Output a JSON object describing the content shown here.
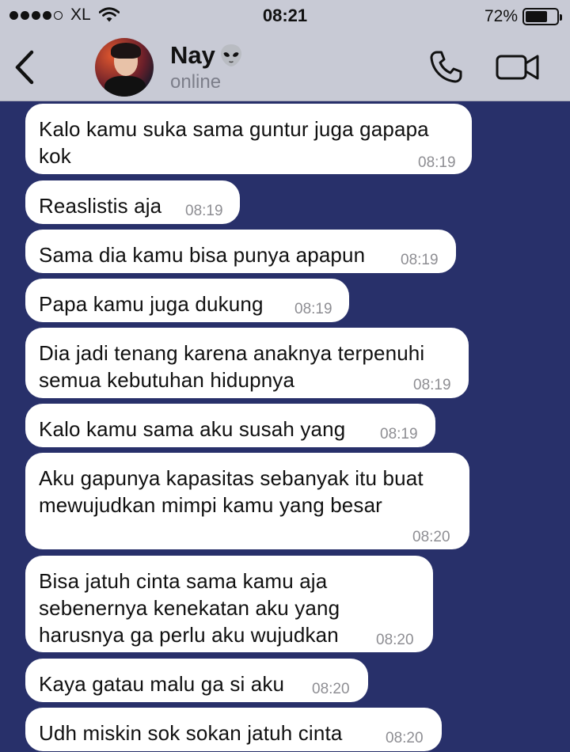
{
  "status_bar": {
    "carrier": "XL",
    "time": "08:21",
    "battery_percent": "72%",
    "battery_level": 0.72,
    "signal_bars_filled": 4,
    "signal_bars_total": 5
  },
  "header": {
    "contact_name": "Nay",
    "contact_status": "online",
    "name_emoji_icon": "alien-emoji-icon",
    "back_icon": "chevron-left-icon",
    "call_icon": "phone-icon",
    "video_icon": "video-camera-icon"
  },
  "colors": {
    "chat_background": "#28306a",
    "header_background": "#c8cad5",
    "bubble": "#ffffff",
    "timestamp": "#8e8e93"
  },
  "messages": [
    {
      "text": "Kalo kamu suka sama guntur juga gapapa\nkok",
      "time": "08:19"
    },
    {
      "text": "Reaslistis aja",
      "time": "08:19"
    },
    {
      "text": "Sama dia kamu bisa punya apapun",
      "time": "08:19"
    },
    {
      "text": "Papa kamu juga dukung",
      "time": "08:19"
    },
    {
      "text": "Dia jadi tenang karena anaknya terpenuhi\nsemua kebutuhan hidupnya",
      "time": "08:19"
    },
    {
      "text": "Kalo kamu sama aku susah yang",
      "time": "08:19"
    },
    {
      "text": "Aku gapunya kapasitas sebanyak itu buat\nmewujudkan mimpi kamu yang besar",
      "time": "08:20"
    },
    {
      "text": "Bisa jatuh cinta sama kamu aja\nsebenernya kenekatan aku yang\nharusnya ga perlu aku wujudkan",
      "time": "08:20"
    },
    {
      "text": "Kaya gatau malu ga si aku",
      "time": "08:20"
    },
    {
      "text": "Udh miskin sok sokan jatuh cinta",
      "time": "08:20"
    }
  ]
}
